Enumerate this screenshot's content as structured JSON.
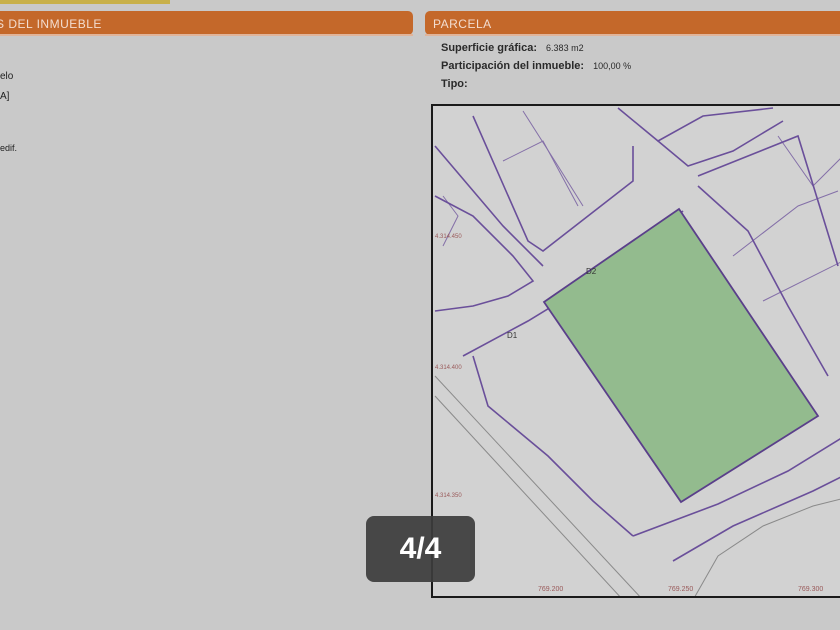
{
  "left_panel": {
    "header_title": "S DEL INMUEBLE",
    "lines": [
      "elo",
      "A]",
      "edif."
    ]
  },
  "parcela": {
    "header_title": "PARCELA",
    "superficie_label": "Superficie gráfica:",
    "superficie_value": "6.383 m2",
    "participacion_label": "Participación del inmueble:",
    "participacion_value": "100,00 %",
    "tipo_label": "Tipo:",
    "tipo_value": ""
  },
  "map": {
    "parcel_fill": "#93bb8e",
    "line_color": "#6a4f9a",
    "labels": {
      "d1": "D1",
      "d2": "D2",
      "y_coord_1": "4.314.450",
      "y_coord_2": "4.314.400",
      "y_coord_3": "4.314.350",
      "x_coord_1": "769.200",
      "x_coord_2": "769.250",
      "x_coord_3": "769.300"
    }
  },
  "pager": {
    "label": "4/4"
  },
  "colors": {
    "header_bg": "#c4682a",
    "background": "#c9c9c9"
  }
}
